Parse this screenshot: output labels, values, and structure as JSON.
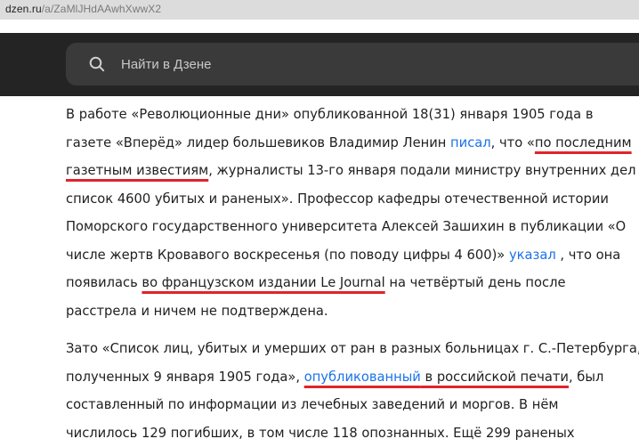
{
  "browser": {
    "url_domain": "dzen.ru",
    "url_path": "/a/ZaMlJHdAAwhXwwX2"
  },
  "header": {
    "search_placeholder": "Найти в Дзене"
  },
  "article": {
    "p1": {
      "l1_a": "В работе «Революционные дни» опубликованной 18(31) января 1905 года в",
      "l2_a": "газете «Вперёд» лидер большевиков Владимир Ленин ",
      "l2_link": "писал",
      "l2_b": ", что «",
      "l2_mark": "по последним",
      "l3_mark": "газетным известиям",
      "l3_b": ", журналисты 13-го января подали министру внутренних дел",
      "l4": "список 4600 убитых и раненых». Профессор кафедры отечественной истории",
      "l5": "Поморского государственного университета Алексей Зашихин в публикации «О",
      "l6_a": "числе жертв Кровавого воскресенья (по поводу цифры 4 600)» ",
      "l6_link": "указал",
      "l6_b": " , что она",
      "l7_a": "появилась ",
      "l7_mark": "во французском издании Le Journal",
      "l7_b": " на четвёртый день после",
      "l8": "расстрела и ничем не подтверждена."
    },
    "p2": {
      "l1": "Зато «Список лиц, убитых и умерших от ран в разных больницах г. С.-Петербурга,",
      "l2_a": "полученных 9 января 1905 года», ",
      "l2_link": "опубликованный",
      "l2_mark": " в российской печати",
      "l2_b": ", был",
      "l3": "составленный по информации из лечебных заведений и моргов. В нём",
      "l4": "числилось 129 погибших, в том числе 118 опознанных. Ещё 299 раненых"
    }
  }
}
